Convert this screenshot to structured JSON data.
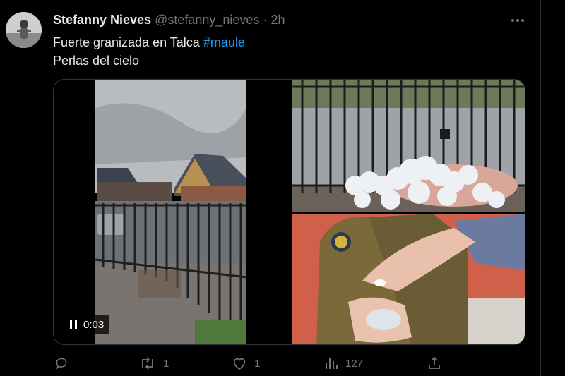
{
  "tweet": {
    "display_name": "Stefanny Nieves",
    "handle": "@stefanny_nieves",
    "separator": "·",
    "time": "2h",
    "text_line1": "Fuerte granizada en Talca",
    "hashtag": "#maule",
    "text_line2": "Perlas del cielo"
  },
  "video": {
    "duration": "0:03"
  },
  "actions": {
    "reply_count": "",
    "retweet_count": "1",
    "like_count": "1",
    "views_count": "127"
  },
  "colors": {
    "accent": "#1d9bf0",
    "muted": "#71767b",
    "text": "#e7e9ea",
    "background": "#000000"
  }
}
